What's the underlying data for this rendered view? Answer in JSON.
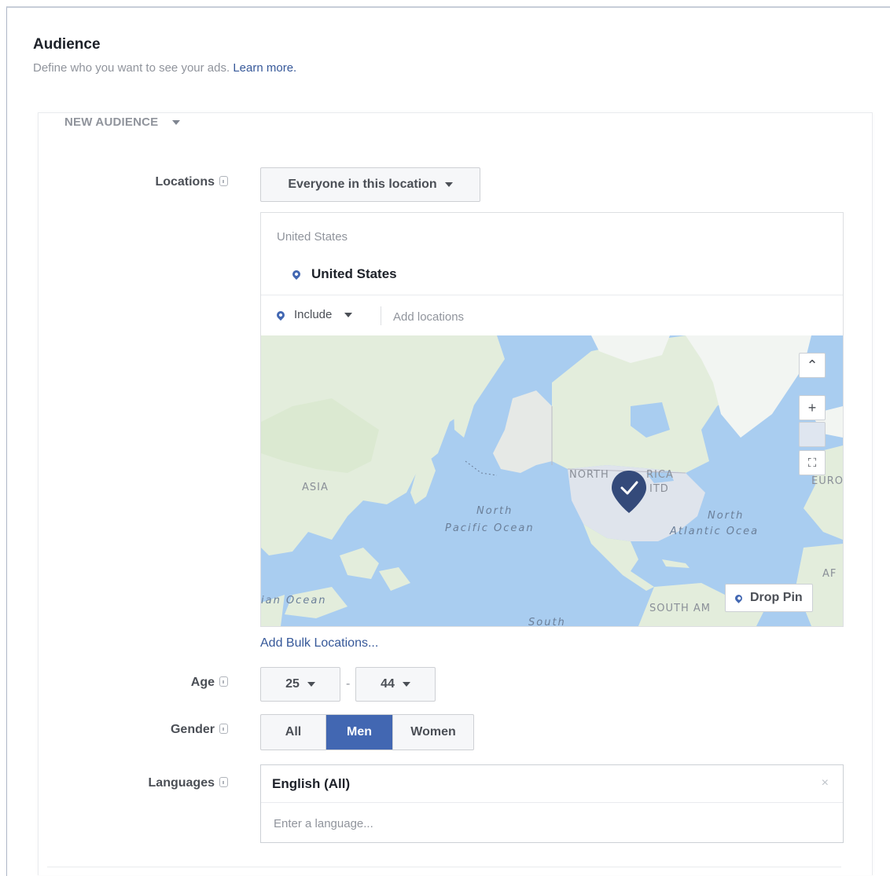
{
  "header": {
    "title": "Audience",
    "subtitle": "Define who you want to see your ads.",
    "learn_more": "Learn more."
  },
  "audience_tab": {
    "label": "NEW AUDIENCE"
  },
  "locations": {
    "label": "Locations",
    "dropdown": "Everyone in this location",
    "group_header": "United States",
    "selected": [
      "United States"
    ],
    "include_label": "Include",
    "add_placeholder": "Add locations",
    "bulk_link": "Add Bulk Locations..."
  },
  "map": {
    "labels": {
      "asia": "ASIA",
      "north_america_a": "NORTH",
      "north_america_b": "RICA",
      "north_america_c": "ITD",
      "euro": "EURO",
      "north_pacific_1": "North",
      "north_pacific_2": "Pacific Ocean",
      "north_atlantic_1": "North",
      "north_atlantic_2": "Atlantic Ocea",
      "south_america": "SOUTH AM",
      "indian_ocean": "ian Ocean",
      "south": "South",
      "af": "AF"
    },
    "drop_pin": "Drop Pin",
    "controls": {
      "up": "⌃",
      "zoom_in": "+",
      "fit": "⛶"
    }
  },
  "age": {
    "label": "Age",
    "min": "25",
    "separator": "-",
    "max": "44"
  },
  "gender": {
    "label": "Gender",
    "options": [
      "All",
      "Men",
      "Women"
    ],
    "selected": "Men"
  },
  "languages": {
    "label": "Languages",
    "selected": "English (All)",
    "remove": "×",
    "placeholder": "Enter a language..."
  },
  "colors": {
    "brand": "#4267b2",
    "link": "#365899",
    "ocean": "#a9cdf0",
    "land": "#e3eddc"
  },
  "icons": {
    "info": "info-icon",
    "pin": "location-pin-icon",
    "caret": "caret-down-icon"
  }
}
